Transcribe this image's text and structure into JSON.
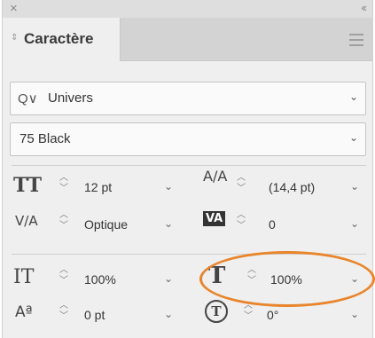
{
  "window": {
    "close_glyph": "×",
    "collapse_glyph": "‹‹"
  },
  "panel": {
    "tab_label": "Caractère",
    "tab_arrows": "⇕",
    "menu_icon": "hamburger-icon"
  },
  "font_family": {
    "value": "Univers",
    "search_prefix": "Q∨"
  },
  "font_style": {
    "value": "75 Black"
  },
  "controls": {
    "font_size": {
      "icon": "TT",
      "value": "12 pt"
    },
    "leading": {
      "icon": "A/A",
      "value": "(14,4 pt)"
    },
    "kerning": {
      "icon": "V/A",
      "value": "Optique"
    },
    "tracking": {
      "icon": "VA",
      "value": "0"
    },
    "vertical_scale": {
      "icon": "IT",
      "value": "100%"
    },
    "horizontal_scale": {
      "icon": "T",
      "value": "100%"
    },
    "baseline_shift": {
      "icon": "Aª",
      "value": "0 pt"
    },
    "character_rotation": {
      "icon": "T-rotate",
      "value": "0°"
    }
  },
  "highlight": {
    "color": "#e8852c"
  }
}
